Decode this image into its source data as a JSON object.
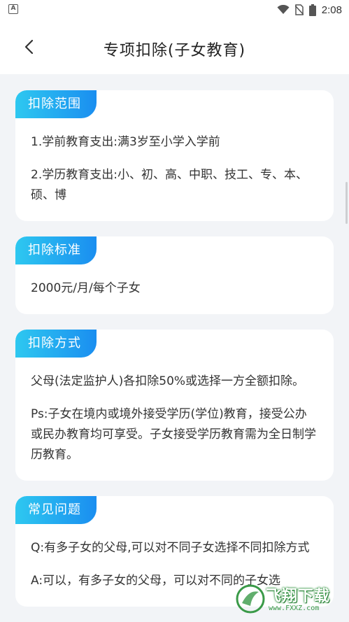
{
  "status_bar": {
    "left_icon_letter": "A",
    "time": "2:08"
  },
  "header": {
    "title": "专项扣除(子女教育)"
  },
  "sections": [
    {
      "tag": "扣除范围",
      "paragraphs": [
        "1.学前教育支出:满3岁至小学入学前",
        "2.学历教育支出:小、初、高、中职、技工、专、本、硕、博"
      ]
    },
    {
      "tag": "扣除标准",
      "paragraphs": [
        "2000元/月/每个子女"
      ]
    },
    {
      "tag": "扣除方式",
      "paragraphs": [
        "父母(法定监护人)各扣除50%或选择一方全额扣除。",
        "Ps:子女在境内或境外接受学历(学位)教育，接受公办或民办教育均可享受。子女接受学历教育需为全日制学历教育。"
      ]
    },
    {
      "tag": "常见问题",
      "paragraphs": [
        "Q:有多子女的父母,可以对不同子女选择不同扣除方式",
        "A:可以，有多子女的父母，可以对不同的子女选"
      ]
    }
  ],
  "watermark": {
    "text": "飞翔下载",
    "url": "www.FXXZ.com"
  },
  "colors": {
    "tag_gradient_start": "#2ec8f0",
    "tag_gradient_end": "#1a8ef0",
    "background": "#f2f4f7"
  }
}
